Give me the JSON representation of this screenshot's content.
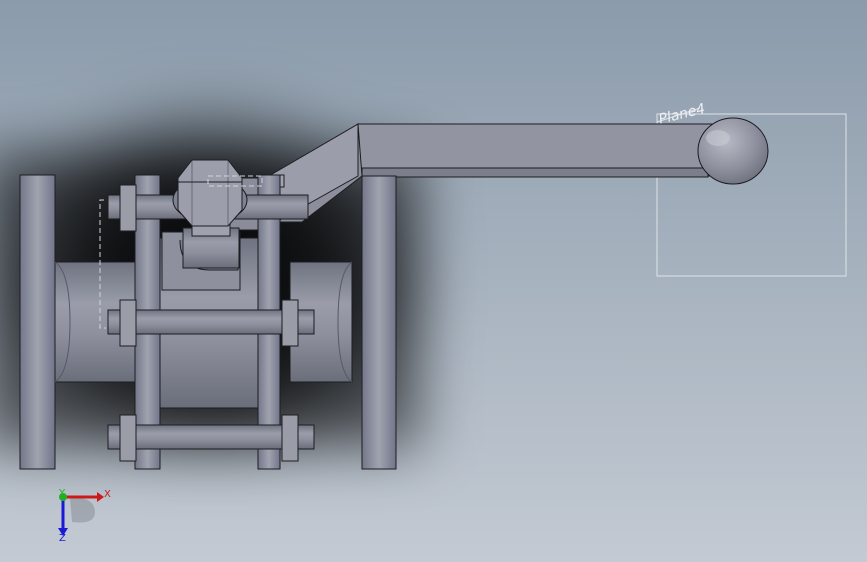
{
  "viewport": {
    "background_top": "#8b9bab",
    "background_bottom": "#c3cad3"
  },
  "model": {
    "name": "ball-valve",
    "metal_color": "#8d909c",
    "edge_color": "#1c1d22"
  },
  "reference_plane": {
    "label": "Plane4",
    "color": "#dfe3e8"
  },
  "triad": {
    "x_label": "X",
    "y_label": "Y",
    "z_label": "Z",
    "x_color": "#cc1a1a",
    "y_color": "#21b021",
    "z_color": "#1a1ad4"
  }
}
